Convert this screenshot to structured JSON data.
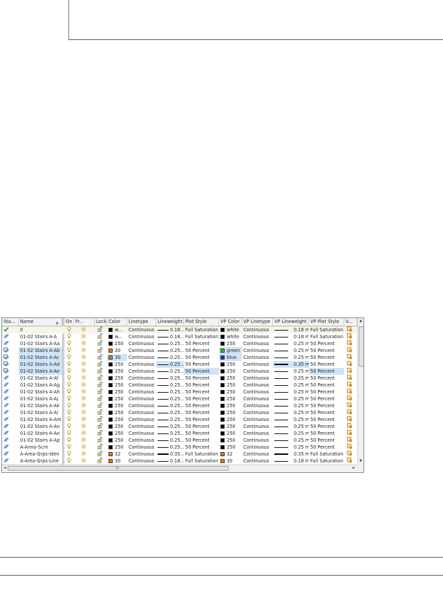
{
  "columns": [
    {
      "key": "status",
      "label": "Sta..."
    },
    {
      "key": "name",
      "label": "Name"
    },
    {
      "key": "on",
      "label": "On"
    },
    {
      "key": "freeze",
      "label": "Fr..."
    },
    {
      "key": "lock",
      "label": "Lock"
    },
    {
      "key": "color",
      "label": "Color"
    },
    {
      "key": "linetype",
      "label": "Linetype"
    },
    {
      "key": "lineweight",
      "label": "Lineweight"
    },
    {
      "key": "plotstyle",
      "label": "Plot Style"
    },
    {
      "key": "vpcolor",
      "label": "VP Color"
    },
    {
      "key": "vplinetype",
      "label": "VP Linetype"
    },
    {
      "key": "vplineweight",
      "label": "VP Lineweight"
    },
    {
      "key": "vpplotstyle",
      "label": "VP Plot Style"
    },
    {
      "key": "vpfreeze",
      "label": "V..."
    }
  ],
  "sort_indicator": "▲",
  "rows": [
    {
      "status": "current",
      "name": "0",
      "color": "w...",
      "color_hex": "#000000",
      "linetype": "Continuous",
      "lineweight": "0.18...",
      "lw_thick": false,
      "plotstyle": "Full Saturation",
      "vpcolor": "white",
      "vpcolor_hex": "#000000",
      "vplinetype": "Continuous",
      "vplineweight": "0.18 mm",
      "vplw_thick": false,
      "vpplotstyle": "Full Saturation",
      "current": true
    },
    {
      "status": "layer",
      "name": "01-02 Stairs A-A",
      "color": "w...",
      "color_hex": "#000000",
      "linetype": "Continuous",
      "lineweight": "0.18...",
      "lw_thick": false,
      "plotstyle": "Full Saturation",
      "vpcolor": "white",
      "vpcolor_hex": "#000000",
      "vplinetype": "Continuous",
      "vplineweight": "0.18 mm",
      "vplw_thick": false,
      "vpplotstyle": "Full Saturation"
    },
    {
      "status": "layer",
      "name": "01-02 Stairs A-Aa",
      "color": "250",
      "color_hex": "#000000",
      "linetype": "Continuous",
      "lineweight": "0.25...",
      "lw_thick": false,
      "plotstyle": "50 Percent",
      "vpcolor": "250",
      "vpcolor_hex": "#000000",
      "vplinetype": "Continuous",
      "vplineweight": "0.25 mm",
      "vplw_thick": false,
      "vpplotstyle": "50 Percent"
    },
    {
      "status": "override",
      "name": "01-02 Stairs A-Ab",
      "name_sel": true,
      "color": "30",
      "color_hex": "#e87f10",
      "linetype": "Continuous",
      "lineweight": "0.25...",
      "lw_thick": false,
      "plotstyle": "50 Percent",
      "vpcolor": "green",
      "vpcolor_hex": "#22cc22",
      "vpcolor_sel": true,
      "vplinetype": "Continuous",
      "vplineweight": "0.25 mm",
      "vplw_thick": false,
      "vpplotstyle": "50 Percent"
    },
    {
      "status": "override",
      "name": "01-02 Stairs A-Ac",
      "name_sel": true,
      "color": "30",
      "color_hex": "#e87f10",
      "color_sel": true,
      "linetype": "Continuous",
      "lineweight": "0.25...",
      "lw_thick": false,
      "plotstyle": "50 Percent",
      "vpcolor": "blue",
      "vpcolor_hex": "#1a2fd6",
      "vpcolor_sel": true,
      "vplinetype": "Continuous",
      "vplineweight": "0.25 mm",
      "vplw_thick": false,
      "vpplotstyle": "50 Percent"
    },
    {
      "status": "override",
      "name": "01-02 Stairs A-Ad",
      "name_sel": true,
      "color": "250",
      "color_hex": "#000000",
      "linetype": "Continuous",
      "lineweight": "0.25...",
      "lw_thick": false,
      "lw_sel": true,
      "plotstyle": "50 Percent",
      "vpcolor": "250",
      "vpcolor_hex": "#000000",
      "vplinetype": "Continuous",
      "vplineweight": "0.35 mm",
      "vplw_thick": true,
      "vplw_sel": true,
      "vpplotstyle": "50 Percent"
    },
    {
      "status": "override",
      "name": "01-02 Stairs A-Ae",
      "name_sel": true,
      "color": "250",
      "color_hex": "#000000",
      "linetype": "Continuous",
      "lineweight": "0.25...",
      "lw_thick": false,
      "plotstyle": "50 Percent",
      "plot_sel": true,
      "vpcolor": "250",
      "vpcolor_hex": "#000000",
      "vplinetype": "Continuous",
      "vplineweight": "0.25 mm",
      "vplw_thick": false,
      "vpplotstyle": "50 Percent",
      "vpplot_sel": true
    },
    {
      "status": "layer",
      "name": "01-02 Stairs A-Af",
      "color": "250",
      "color_hex": "#000000",
      "linetype": "Continuous",
      "lineweight": "0.25...",
      "lw_thick": false,
      "plotstyle": "50 Percent",
      "vpcolor": "250",
      "vpcolor_hex": "#000000",
      "vplinetype": "Continuous",
      "vplineweight": "0.25 mm",
      "vplw_thick": false,
      "vpplotstyle": "50 Percent"
    },
    {
      "status": "layer",
      "name": "01-02 Stairs A-Ag",
      "color": "250",
      "color_hex": "#000000",
      "linetype": "Continuous",
      "lineweight": "0.25...",
      "lw_thick": false,
      "plotstyle": "50 Percent",
      "vpcolor": "250",
      "vpcolor_hex": "#000000",
      "vplinetype": "Continuous",
      "vplineweight": "0.25 mm",
      "vplw_thick": false,
      "vpplotstyle": "50 Percent"
    },
    {
      "status": "layer",
      "name": "01-02 Stairs A-Ah",
      "color": "250",
      "color_hex": "#000000",
      "linetype": "Continuous",
      "lineweight": "0.25...",
      "lw_thick": false,
      "plotstyle": "50 Percent",
      "vpcolor": "250",
      "vpcolor_hex": "#000000",
      "vplinetype": "Continuous",
      "vplineweight": "0.25 mm",
      "vplw_thick": false,
      "vpplotstyle": "50 Percent"
    },
    {
      "status": "layer",
      "name": "01-02 Stairs A-Aj",
      "color": "250",
      "color_hex": "#000000",
      "linetype": "Continuous",
      "lineweight": "0.25...",
      "lw_thick": false,
      "plotstyle": "50 Percent",
      "vpcolor": "250",
      "vpcolor_hex": "#000000",
      "vplinetype": "Continuous",
      "vplineweight": "0.25 mm",
      "vplw_thick": false,
      "vpplotstyle": "50 Percent"
    },
    {
      "status": "layer",
      "name": "01-02 Stairs A-Ak",
      "color": "250",
      "color_hex": "#000000",
      "linetype": "Continuous",
      "lineweight": "0.25...",
      "lw_thick": false,
      "plotstyle": "50 Percent",
      "vpcolor": "250",
      "vpcolor_hex": "#000000",
      "vplinetype": "Continuous",
      "vplineweight": "0.25 mm",
      "vplw_thick": false,
      "vpplotstyle": "50 Percent"
    },
    {
      "status": "layer",
      "name": "01-02 Stairs A-Al",
      "color": "250",
      "color_hex": "#000000",
      "linetype": "Continuous",
      "lineweight": "0.25...",
      "lw_thick": false,
      "plotstyle": "50 Percent",
      "vpcolor": "250",
      "vpcolor_hex": "#000000",
      "vplinetype": "Continuous",
      "vplineweight": "0.25 mm",
      "vplw_thick": false,
      "vpplotstyle": "50 Percent"
    },
    {
      "status": "layer",
      "name": "01-02 Stairs A-Am",
      "color": "250",
      "color_hex": "#000000",
      "linetype": "Continuous",
      "lineweight": "0.25...",
      "lw_thick": false,
      "plotstyle": "50 Percent",
      "vpcolor": "250",
      "vpcolor_hex": "#000000",
      "vplinetype": "Continuous",
      "vplineweight": "0.25 mm",
      "vplw_thick": false,
      "vpplotstyle": "50 Percent"
    },
    {
      "status": "layer",
      "name": "01-02 Stairs A-An",
      "color": "250",
      "color_hex": "#000000",
      "linetype": "Continuous",
      "lineweight": "0.25...",
      "lw_thick": false,
      "plotstyle": "50 Percent",
      "vpcolor": "250",
      "vpcolor_hex": "#000000",
      "vplinetype": "Continuous",
      "vplineweight": "0.25 mm",
      "vplw_thick": false,
      "vpplotstyle": "50 Percent"
    },
    {
      "status": "layer",
      "name": "01-02 Stairs A-Ao",
      "color": "250",
      "color_hex": "#000000",
      "linetype": "Continuous",
      "lineweight": "0.25...",
      "lw_thick": false,
      "plotstyle": "50 Percent",
      "vpcolor": "250",
      "vpcolor_hex": "#000000",
      "vplinetype": "Continuous",
      "vplineweight": "0.25 mm",
      "vplw_thick": false,
      "vpplotstyle": "50 Percent"
    },
    {
      "status": "layer",
      "name": "01-02 Stairs A-Ap",
      "color": "250",
      "color_hex": "#000000",
      "linetype": "Continuous",
      "lineweight": "0.25...",
      "lw_thick": false,
      "plotstyle": "50 Percent",
      "vpcolor": "250",
      "vpcolor_hex": "#000000",
      "vplinetype": "Continuous",
      "vplineweight": "0.25 mm",
      "vplw_thick": false,
      "vpplotstyle": "50 Percent"
    },
    {
      "status": "layer",
      "name": "A-Anno-Scrn",
      "color": "250",
      "color_hex": "#000000",
      "linetype": "Continuous",
      "lineweight": "0.25...",
      "lw_thick": false,
      "plotstyle": "50 Percent",
      "vpcolor": "250",
      "vpcolor_hex": "#000000",
      "vplinetype": "Continuous",
      "vplineweight": "0.25 mm",
      "vplw_thick": false,
      "vpplotstyle": "50 Percent"
    },
    {
      "status": "layer",
      "name": "A-Area-Grps-Iden",
      "color": "32",
      "color_hex": "#e87f10",
      "linetype": "Continuous",
      "lineweight": "0.35...",
      "lw_thick": true,
      "plotstyle": "Full Saturation",
      "vpcolor": "32",
      "vpcolor_hex": "#e87f10",
      "vplinetype": "Continuous",
      "vplineweight": "0.35 mm",
      "vplw_thick": true,
      "vpplotstyle": "Full Saturation"
    },
    {
      "status": "layer",
      "name": "A-Area-Grps-Line",
      "color": "30",
      "color_hex": "#e87f10",
      "linetype": "Continuous",
      "lineweight": "0.18...",
      "lw_thick": false,
      "plotstyle": "Full Saturation",
      "vpcolor": "30",
      "vpcolor_hex": "#e87f10",
      "vplinetype": "Continuous",
      "vplineweight": "0.18 mm",
      "vplw_thick": false,
      "vpplotstyle": "Full Saturation"
    }
  ],
  "scrollbar_arrows": {
    "up": "▲",
    "down": "▼",
    "left": "◄",
    "right": "►"
  },
  "scroll_grip": "≡",
  "icons": {
    "on": "lightbulb-icon",
    "freeze": "sun-icon",
    "lock": "padlock-open-icon",
    "vpfreeze": "vp-freeze-icon",
    "current": "checkmark-icon",
    "layer": "layer-icon",
    "override": "layer-override-icon"
  }
}
